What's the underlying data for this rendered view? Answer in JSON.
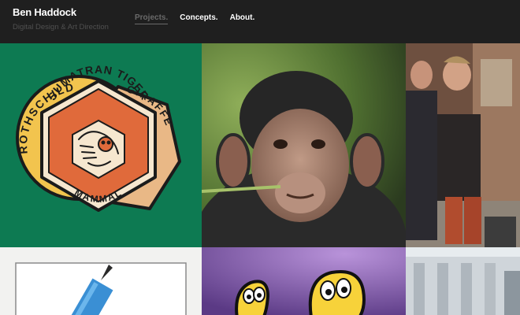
{
  "brand": {
    "name": "Ben Haddock",
    "tagline": "Digital Design & Art Direction"
  },
  "nav": [
    {
      "label": "Projects.",
      "active": true
    },
    {
      "label": "Concepts.",
      "active": false
    },
    {
      "label": "About.",
      "active": false
    }
  ],
  "tiles": {
    "badge": {
      "title": "SUMATRAN TIGER",
      "subtitle": "MAMMAL",
      "back_left": "ROTHSCHILD",
      "back_right": "GIRAFFE"
    }
  },
  "colors": {
    "header_bg": "#1f1f1f",
    "green_tile": "#0d7a52",
    "badge_orange": "#e06a3b",
    "badge_yellow": "#f2c44e",
    "badge_tan": "#e9b886",
    "purple_tile": "#6c4a93"
  }
}
